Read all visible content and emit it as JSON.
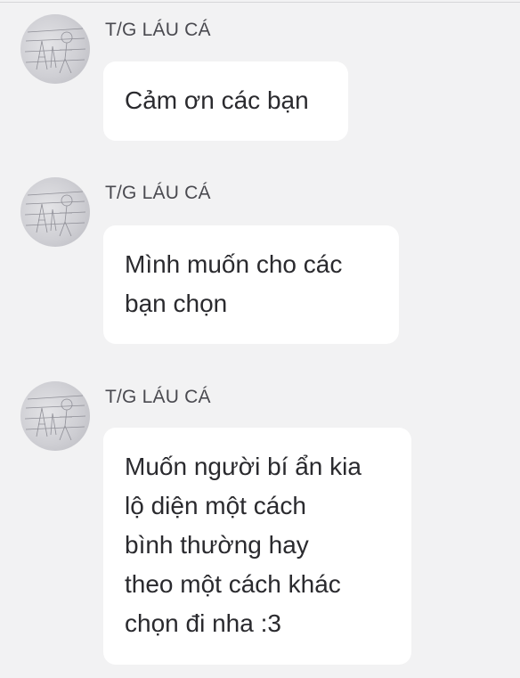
{
  "messages": [
    {
      "sender": "T/G LÁU CÁ",
      "lines": [
        "Cảm ơn các bạn"
      ]
    },
    {
      "sender": "T/G LÁU CÁ",
      "lines": [
        "Mình muốn cho các",
        "bạn chọn"
      ]
    },
    {
      "sender": "T/G LÁU CÁ",
      "lines": [
        "Muốn người bí ẩn kia",
        "lộ diện một cách",
        "bình thường hay",
        "theo một cách khác",
        "chọn đi nha :3"
      ]
    }
  ]
}
